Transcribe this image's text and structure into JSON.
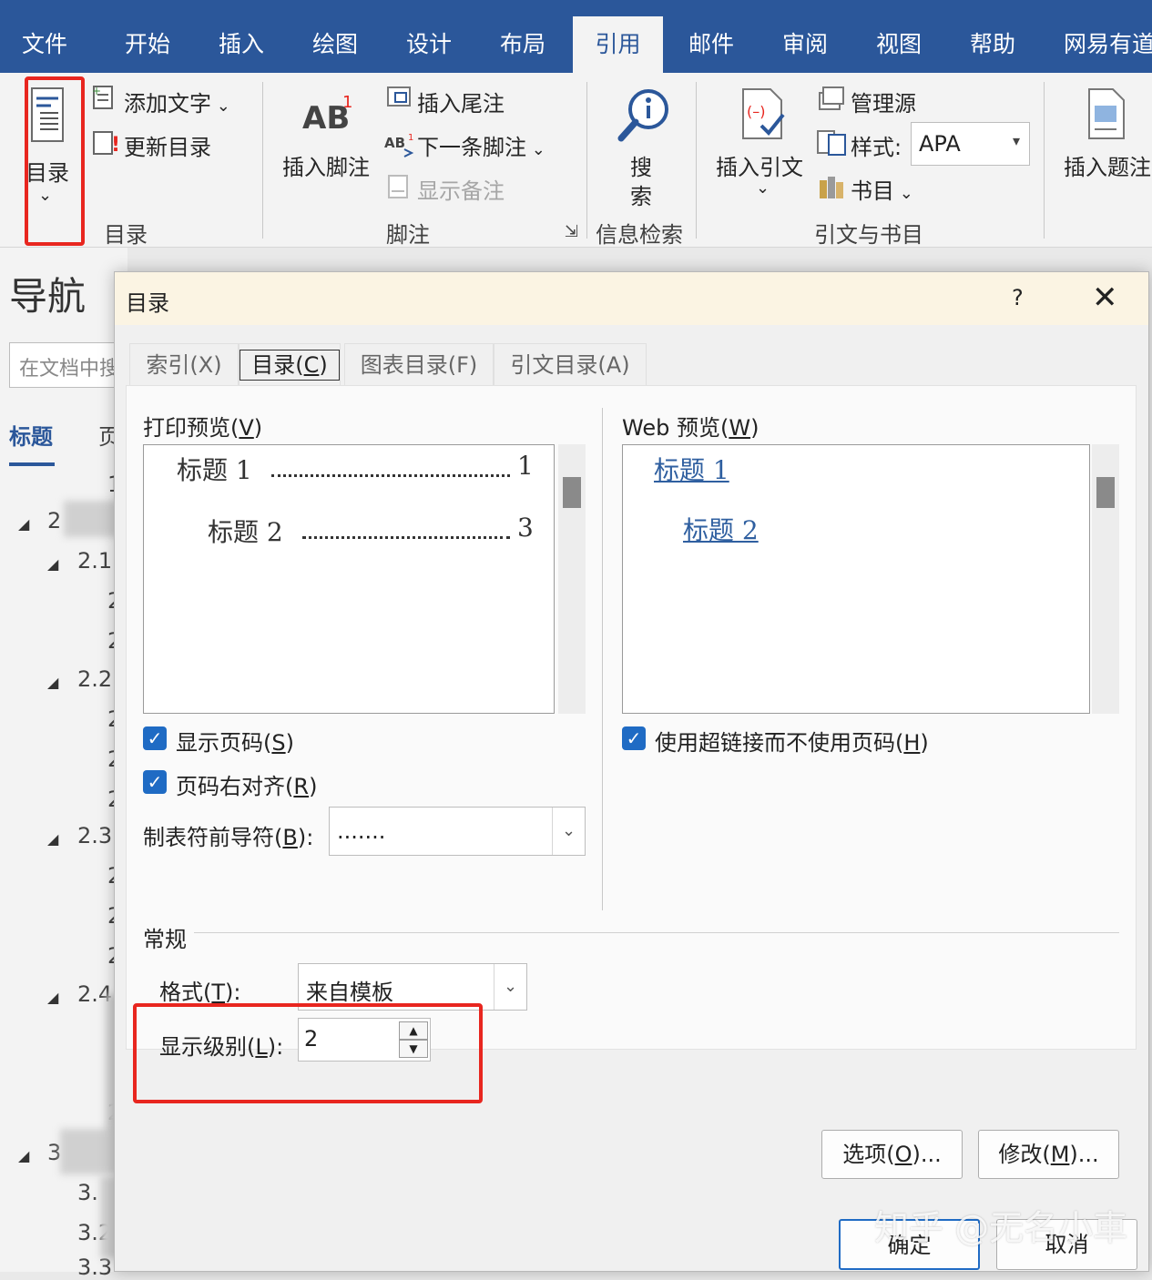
{
  "menu": {
    "file": "文件",
    "home": "开始",
    "insert": "插入",
    "draw": "绘图",
    "design": "设计",
    "layout": "布局",
    "references": "引用",
    "mailings": "邮件",
    "review": "审阅",
    "view": "视图",
    "help": "帮助",
    "youdao": "网易有道"
  },
  "ribbon": {
    "toc_btn": "目录",
    "add_text": "添加文字",
    "update_toc": "更新目录",
    "toc_group": "目录",
    "ab_glyph": "AB",
    "ab_sup": "1",
    "insert_footnote": "插入脚注",
    "insert_endnote": "插入尾注",
    "next_footnote": "下一条脚注",
    "show_notes": "显示备注",
    "footnote_group": "脚注",
    "search_line1": "搜",
    "search_line2": "索",
    "research_group": "信息检索",
    "insert_citation": "插入引文",
    "manage_sources": "管理源",
    "style_label": "样式:",
    "style_value": "APA",
    "bibliography": "书目",
    "citations_group": "引文与书目",
    "insert_caption": "插入题注"
  },
  "nav": {
    "title": "导航",
    "search_placeholder": "在文档中搜",
    "tab_headings": "标题",
    "tab_pages": "页",
    "nodes": [
      "1",
      "2",
      "2.1",
      "2",
      "2",
      "2.2",
      "2",
      "2",
      "2",
      "2.3",
      "2",
      "2",
      "2",
      "2.4",
      "2",
      "3",
      "3.",
      "3.2",
      "3.3"
    ]
  },
  "dialog": {
    "title": "目录",
    "help": "?",
    "close": "✕",
    "tabs": {
      "index": "索引(X)",
      "toc_pre": "目录(",
      "toc_key": "C",
      "toc_post": ")",
      "figures": "图表目录(F)",
      "authorities": "引文目录(A)"
    },
    "print_preview": {
      "pre": "打印预览(",
      "key": "V",
      "post": ")"
    },
    "web_preview": {
      "pre": "Web 预览(",
      "key": "W",
      "post": ")"
    },
    "print_entries": [
      {
        "text": "标题  1",
        "page": "1"
      },
      {
        "text": "标题  2",
        "page": "3"
      }
    ],
    "web_entries": [
      "标题  1",
      "标题  2"
    ],
    "show_page_numbers": {
      "pre": "显示页码(",
      "key": "S",
      "post": ")"
    },
    "right_align": {
      "pre": "页码右对齐(",
      "key": "R",
      "post": ")"
    },
    "tab_leader": {
      "pre": "制表符前导符(",
      "key": "B",
      "post": "):"
    },
    "tab_leader_value": ".......",
    "use_hyperlinks": {
      "pre": "使用超链接而不使用页码(",
      "key": "H",
      "post": ")"
    },
    "general": "常规",
    "formats": {
      "pre": "格式(",
      "key": "T",
      "post": "):"
    },
    "formats_value": "来自模板",
    "show_levels": {
      "pre": "显示级别(",
      "key": "L",
      "post": "):"
    },
    "show_levels_value": "2",
    "options_btn": {
      "pre": "选项(",
      "key": "O",
      "post": ")..."
    },
    "modify_btn": {
      "pre": "修改(",
      "key": "M",
      "post": ")..."
    },
    "ok": "确定",
    "cancel": "取消"
  },
  "watermark": "知乎 @无名小車",
  "colors": {
    "menubar": "#2b579a",
    "highlight": "#e8261f",
    "checkbox": "#1f6bc4",
    "link": "#2f5fa0",
    "dialog_title_bg": "#fbf4e3"
  },
  "icons": [
    "toc-icon",
    "add-text-icon",
    "update-toc-icon",
    "insert-endnote-icon",
    "next-footnote-icon",
    "show-notes-icon",
    "search-icon",
    "insert-citation-icon",
    "manage-sources-icon",
    "style-icon",
    "bibliography-icon",
    "insert-caption-icon"
  ]
}
